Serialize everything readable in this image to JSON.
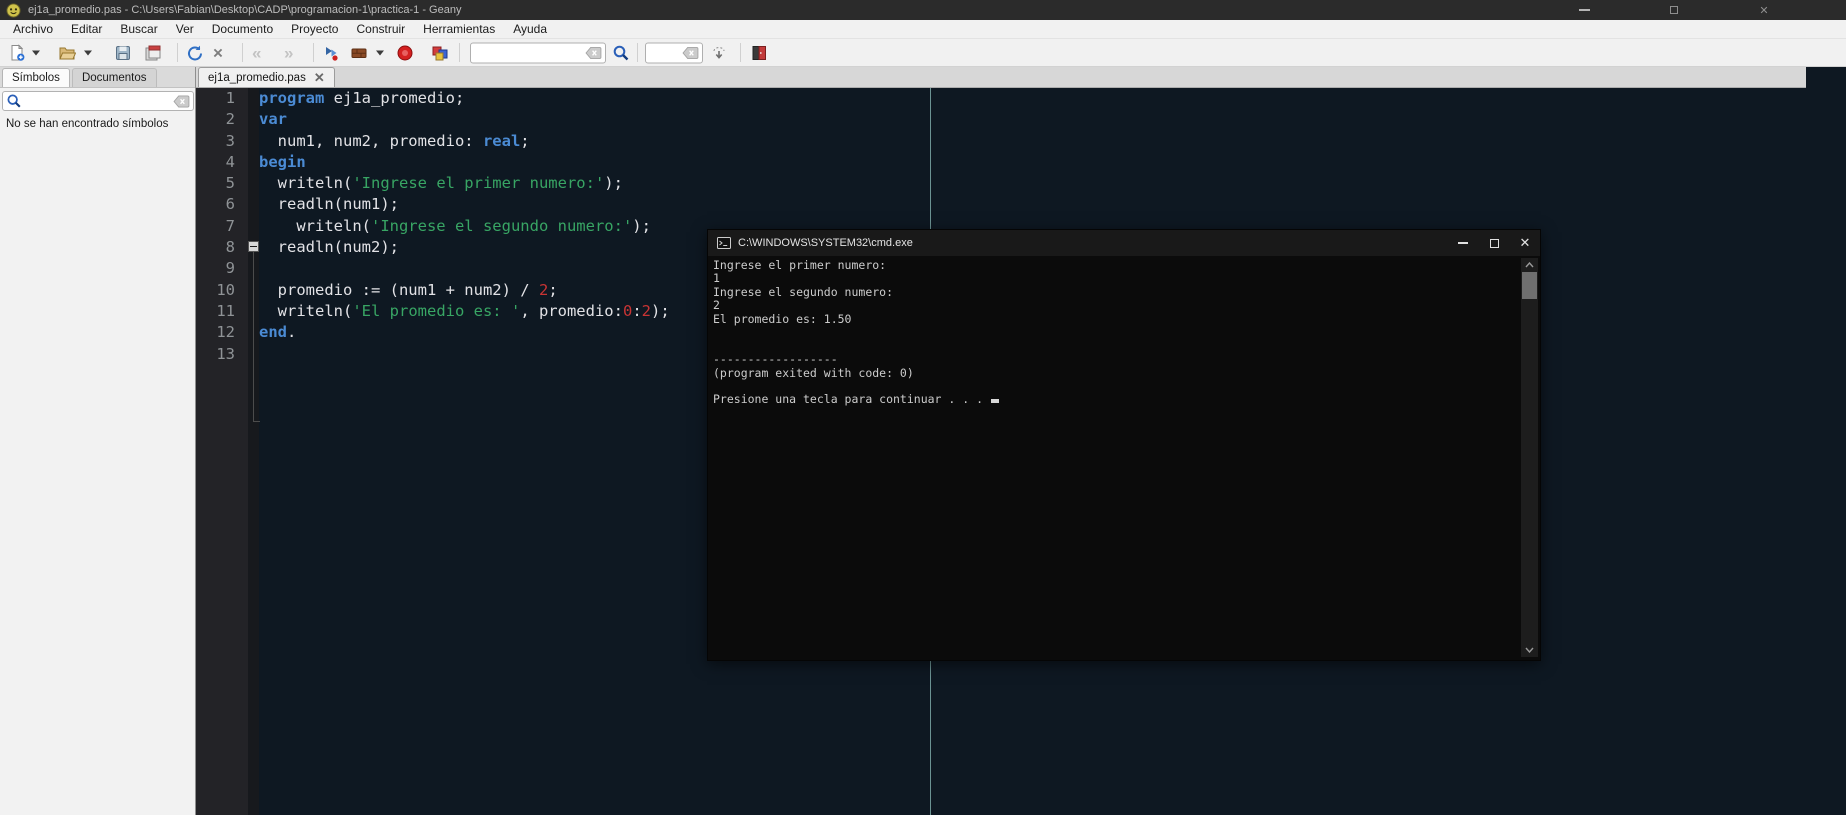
{
  "window": {
    "title": "ej1a_promedio.pas - C:\\Users\\Fabian\\Desktop\\CADP\\programacion-1\\practica-1 - Geany"
  },
  "menubar": {
    "items": [
      "Archivo",
      "Editar",
      "Buscar",
      "Ver",
      "Documento",
      "Proyecto",
      "Construir",
      "Herramientas",
      "Ayuda"
    ]
  },
  "toolbar": {
    "icons": [
      "new-file",
      "open-file",
      "save",
      "save-all",
      "revert",
      "close-document",
      "navigate-back",
      "navigate-forward",
      "compile",
      "build",
      "run",
      "color-chooser",
      "search",
      "goto-line",
      "quit"
    ],
    "search_value": "",
    "goto_value": ""
  },
  "sidebar": {
    "tabs": [
      "Símbolos",
      "Documentos"
    ],
    "filter_value": "",
    "empty_message": "No se han encontrado símbolos"
  },
  "editor": {
    "tab_label": "ej1a_promedio.pas",
    "lines": [
      [
        [
          "k",
          "program"
        ],
        [
          "p",
          " ej1a_promedio;"
        ]
      ],
      [
        [
          "k",
          "var"
        ]
      ],
      [
        [
          "p",
          "  num1, num2, promedio: "
        ],
        [
          "k",
          "real"
        ],
        [
          "p",
          ";"
        ]
      ],
      [
        [
          "k",
          "begin"
        ]
      ],
      [
        [
          "p",
          "  writeln("
        ],
        [
          "s",
          "'Ingrese el primer numero:'"
        ],
        [
          "p",
          ");"
        ]
      ],
      [
        [
          "p",
          "  readln(num1);"
        ]
      ],
      [
        [
          "p",
          "    writeln("
        ],
        [
          "s",
          "'Ingrese el segundo numero:'"
        ],
        [
          "p",
          ");"
        ]
      ],
      [
        [
          "p",
          "  readln(num2);"
        ]
      ],
      [],
      [
        [
          "p",
          "  promedio := (num1 + num2) / "
        ],
        [
          "n",
          "2"
        ],
        [
          "p",
          ";"
        ]
      ],
      [
        [
          "p",
          "  writeln("
        ],
        [
          "s",
          "'El promedio es: '"
        ],
        [
          "p",
          ", promedio:"
        ],
        [
          "n",
          "0"
        ],
        [
          "p",
          ":"
        ],
        [
          "n",
          "2"
        ],
        [
          "p",
          ");"
        ]
      ],
      [
        [
          "k",
          "end"
        ],
        [
          "p",
          "."
        ]
      ],
      []
    ]
  },
  "cmd": {
    "title": "C:\\WINDOWS\\SYSTEM32\\cmd.exe",
    "lines": [
      "Ingrese el primer numero:",
      "1",
      "Ingrese el segundo numero:",
      "2",
      "El promedio es: 1.50",
      "",
      "",
      "------------------",
      "(program exited with code: 0)",
      "",
      "Presione una tecla para continuar . . . "
    ],
    "cursor": true
  },
  "colors": {
    "editor_bg": "#0e1822",
    "cmd_bg": "#0b0b0b",
    "keyword": "#4b8bd4",
    "plain": "#e2e2e6",
    "string": "#38a564",
    "number": "#c93434",
    "margin_line": "#6b9393"
  }
}
